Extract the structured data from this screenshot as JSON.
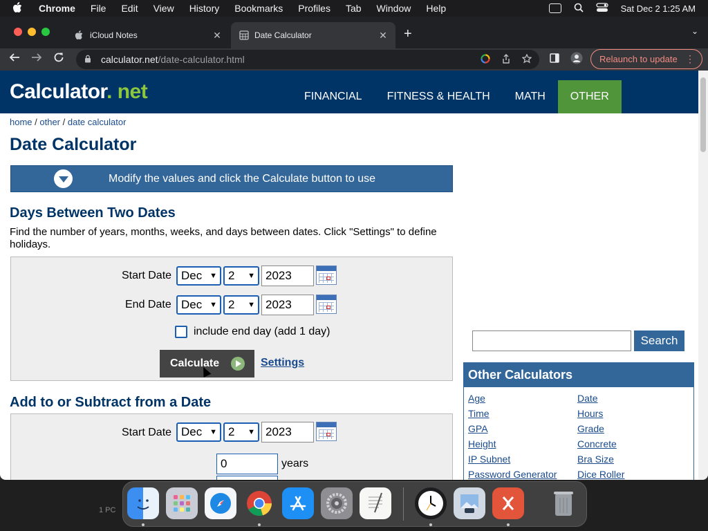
{
  "menubar": {
    "app_name": "Chrome",
    "items": [
      "File",
      "Edit",
      "View",
      "History",
      "Bookmarks",
      "Profiles",
      "Tab",
      "Window",
      "Help"
    ],
    "clock": "Sat Dec 2  1:25 AM"
  },
  "browser": {
    "tabs": [
      {
        "title": "iCloud Notes",
        "close": "✕"
      },
      {
        "title": "Date Calculator",
        "close": "✕"
      }
    ],
    "new_tab": "+",
    "tab_menu": "⌄",
    "url_host": "calculator.net",
    "url_path": "/date-calculator.html",
    "relaunch_label": "Relaunch to update",
    "relaunch_color": "#f28b82"
  },
  "site": {
    "logo_main": "Calculator",
    "logo_ext": ". net",
    "nav": [
      "FINANCIAL",
      "FITNESS & HEALTH",
      "MATH",
      "OTHER"
    ],
    "active_nav": "OTHER",
    "breadcrumb": {
      "home": "home",
      "sep1": " / ",
      "other": "other",
      "sep2": " / ",
      "current": "date calculator"
    },
    "page_title": "Date Calculator",
    "notice": "Modify the values and click the Calculate button to use",
    "brand_color": "#003366",
    "accent_color": "#51953b"
  },
  "days_between": {
    "heading": "Days Between Two Dates",
    "description": "Find the number of years, months, weeks, and days between dates. Click \"Settings\" to define holidays.",
    "start_label": "Start Date",
    "start": {
      "month": "Dec",
      "day": "2",
      "year": "2023"
    },
    "end_label": "End Date",
    "end": {
      "month": "Dec",
      "day": "2",
      "year": "2023"
    },
    "include_end_label": "include end day (add 1 day)",
    "include_end_checked": false,
    "calculate_label": "Calculate",
    "settings_label": "Settings"
  },
  "add_subtract": {
    "heading": "Add to or Subtract from a Date",
    "start_label": "Start Date",
    "start": {
      "month": "Dec",
      "day": "2",
      "year": "2023"
    },
    "years_value": "0",
    "years_label": "years"
  },
  "sidebar": {
    "search_placeholder": "",
    "search_label": "Search",
    "other_title": "Other Calculators",
    "links_left": [
      "Age",
      "Time",
      "GPA",
      "Height",
      "IP Subnet",
      "Password Generator"
    ],
    "links_right": [
      "Date",
      "Hours",
      "Grade",
      "Concrete",
      "Bra Size",
      "Dice Roller"
    ]
  },
  "dock": {
    "apps": [
      "finder",
      "launchpad",
      "safari",
      "chrome",
      "app-store",
      "system-settings",
      "textedit",
      "clock",
      "preview",
      "remote-desktop",
      "trash"
    ],
    "desktop_label": "1 PC"
  }
}
